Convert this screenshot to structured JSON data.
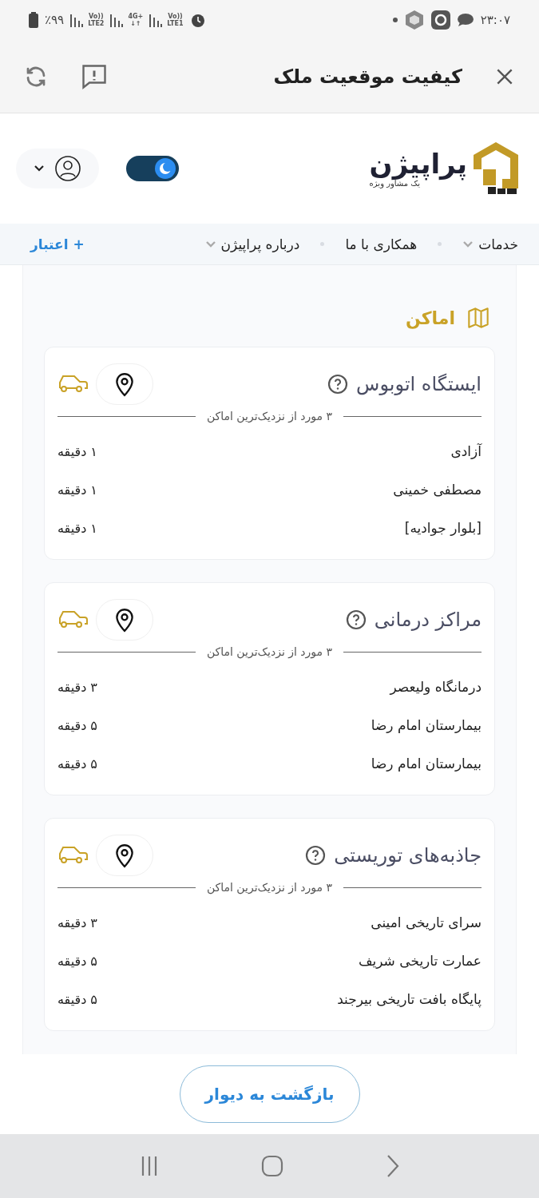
{
  "status_bar": {
    "time": "۲۳:۰۷",
    "battery": "٪۹۹",
    "network": [
      {
        "top": "Vo))",
        "bottom": "LTE1"
      },
      {
        "top": "4G+",
        "bottom": "↓↑"
      },
      {
        "top": "Vo))",
        "bottom": "LTE2"
      }
    ]
  },
  "app_bar": {
    "title": "کیفیت موقعیت ملک"
  },
  "site_header": {
    "logo": "پراپیژن",
    "tagline": "یک مشاور ویژه",
    "dark_mode": {
      "on": true
    }
  },
  "nav": {
    "items": [
      {
        "label": "خدمات",
        "dropdown": true
      },
      {
        "label": "همکاری با ما",
        "dropdown": false
      },
      {
        "label": "درباره پراپیژن",
        "dropdown": true
      }
    ],
    "credit": "+ اعتبار"
  },
  "section": {
    "title": "اماکن"
  },
  "cards": [
    {
      "title": "ایستگاه اتوبوس",
      "subtitle": "۳ مورد از نزدیک‌ترین اماکن",
      "items": [
        {
          "name": "آزادی",
          "time": "۱ دقیقه"
        },
        {
          "name": "مصطفی خمینی",
          "time": "۱ دقیقه"
        },
        {
          "name": "[بلوار جوادیه]",
          "time": "۱ دقیقه"
        }
      ]
    },
    {
      "title": "مراکز درمانی",
      "subtitle": "۳ مورد از نزدیک‌ترین اماکن",
      "items": [
        {
          "name": "درمانگاه ولیعصر",
          "time": "۳ دقیقه"
        },
        {
          "name": "بیمارستان امام رضا",
          "time": "۵ دقیقه"
        },
        {
          "name": "بیمارستان امام رضا",
          "time": "۵ دقیقه"
        }
      ]
    },
    {
      "title": "جاذبه‌های توریستی",
      "subtitle": "۳ مورد از نزدیک‌ترین اماکن",
      "items": [
        {
          "name": "سرای تاریخی امینی",
          "time": "۳ دقیقه"
        },
        {
          "name": "عمارت تاریخی شریف",
          "time": "۵ دقیقه"
        },
        {
          "name": "پایگاه بافت تاریخی بیرجند",
          "time": "۵ دقیقه"
        }
      ]
    }
  ],
  "back_button": "بازگشت به دیوار"
}
